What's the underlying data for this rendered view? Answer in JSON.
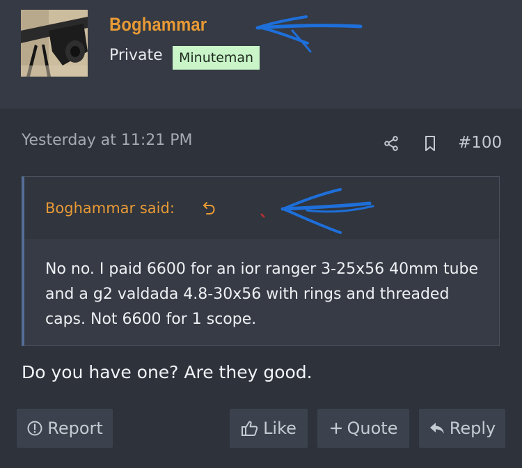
{
  "user": {
    "name": "Boghammar",
    "title": "Private",
    "badge": "Minuteman"
  },
  "post": {
    "date": "Yesterday at 11:21 PM",
    "number": "#100",
    "quote": {
      "author": "Boghammar said:",
      "text": "No no. I paid 6600 for an ior ranger 3-25x56 40mm tube and a g2 valdada 4.8-30x56 with rings and threaded caps. Not 6600 for 1 scope."
    },
    "message": "Do you have one? Are they good."
  },
  "actions": {
    "report": "Report",
    "like": "Like",
    "quote": "Quote",
    "reply": "Reply"
  },
  "icons": {
    "share": "share-icon",
    "bookmark": "bookmark-icon",
    "jump": "quote-jump-icon",
    "report": "alert-circle-icon",
    "like": "thumbs-up-icon",
    "quote": "plus-icon",
    "reply": "reply-arrow-icon"
  },
  "colors": {
    "page_bg": "#2d323b",
    "header_bg": "#353a44",
    "username": "#e89a35",
    "badge_bg": "#c9f5c9",
    "quote_border": "#556f99",
    "button_bg": "#3c424d",
    "annotation_scribble": "#1e6fd9"
  }
}
